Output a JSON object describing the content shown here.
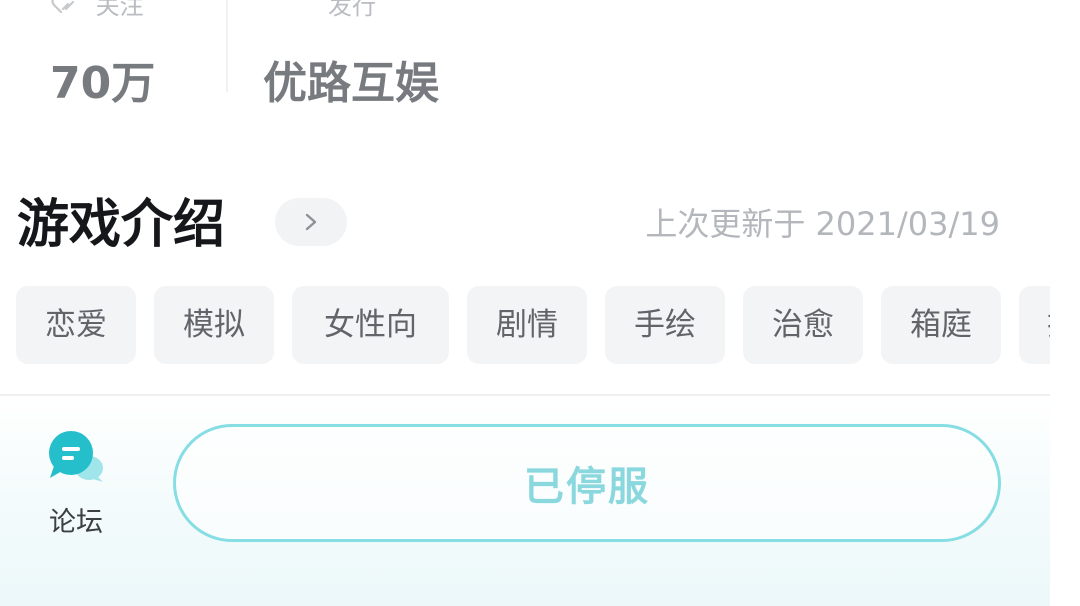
{
  "stats": {
    "follow": {
      "label": "关注",
      "value": "70万"
    },
    "publisher": {
      "label": "发行",
      "value": "优路互娱"
    }
  },
  "intro": {
    "title": "游戏介绍",
    "updated": "上次更新于 2021/03/19"
  },
  "tags": [
    "恋爱",
    "模拟",
    "女性向",
    "剧情",
    "手绘",
    "治愈",
    "箱庭",
    "换"
  ],
  "bottom_bar": {
    "forum_label": "论坛",
    "status_button": "已停服"
  },
  "colors": {
    "accent": "#86dde3",
    "forum_icon": "#2cc3cf",
    "title": "#15171a"
  }
}
